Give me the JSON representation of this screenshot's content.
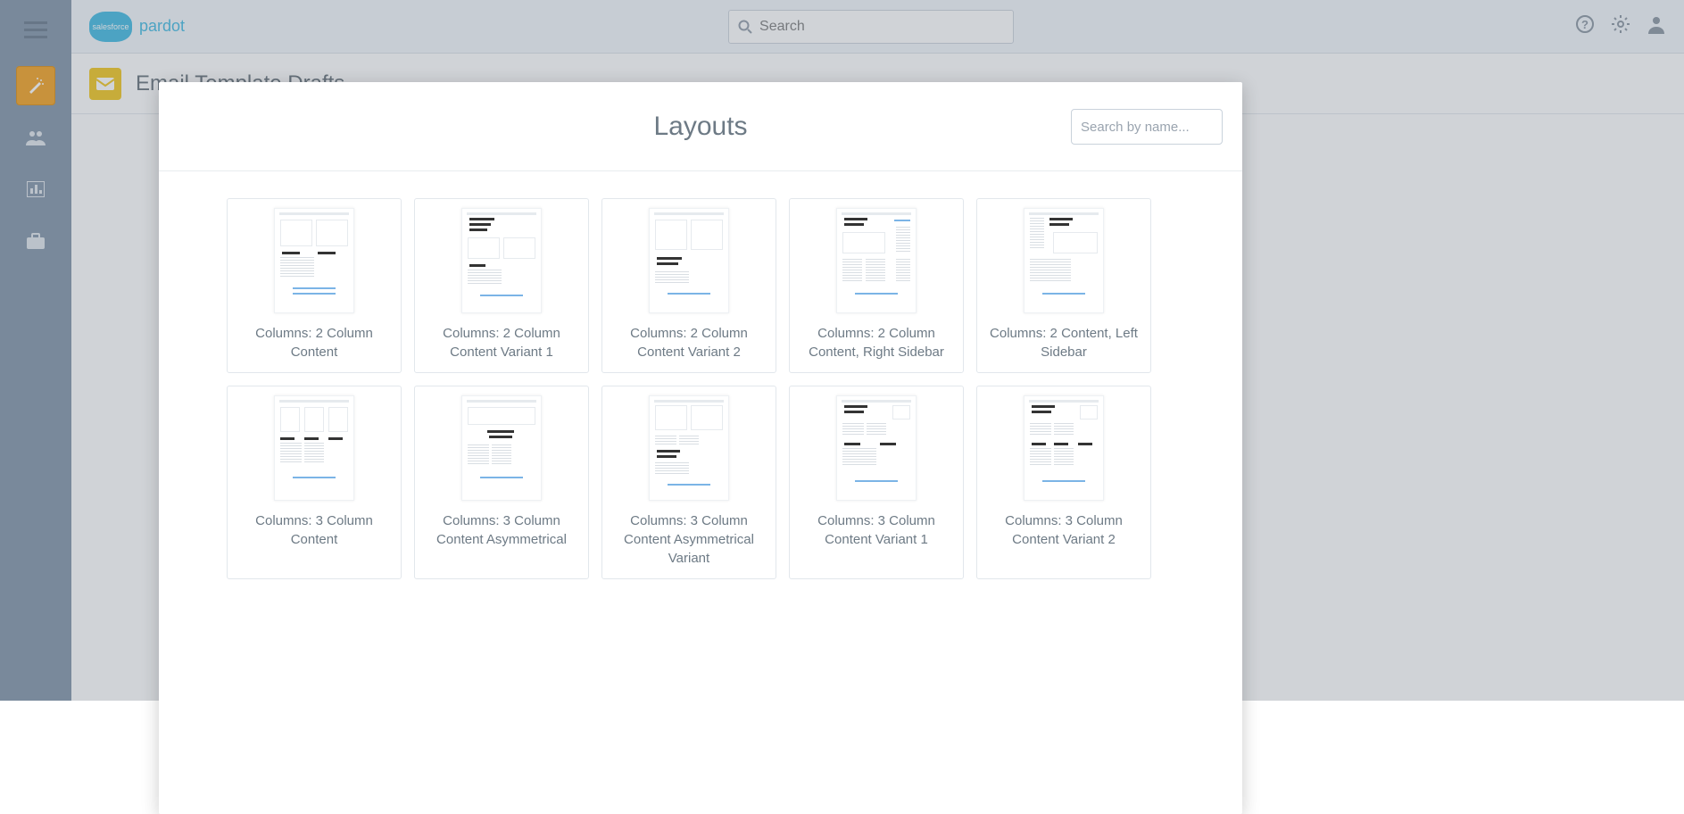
{
  "logo": {
    "cloud_text": "salesforce",
    "product": "pardot"
  },
  "top_search": {
    "placeholder": "Search"
  },
  "page": {
    "title": "Email Template Drafts"
  },
  "modal": {
    "title": "Layouts",
    "search_placeholder": "Search by name...",
    "layouts": [
      {
        "name": "Columns: 2 Column Content"
      },
      {
        "name": "Columns: 2 Column Content Variant 1"
      },
      {
        "name": "Columns: 2 Column Content Variant 2"
      },
      {
        "name": "Columns: 2 Column Content, Right Sidebar"
      },
      {
        "name": "Columns: 2 Content, Left Sidebar"
      },
      {
        "name": "Columns: 3 Column Content"
      },
      {
        "name": "Columns: 3 Column Content Asymmetrical"
      },
      {
        "name": "Columns: 3 Column Content Asymmetrical Variant"
      },
      {
        "name": "Columns: 3 Column Content Variant 1"
      },
      {
        "name": "Columns: 3 Column Content Variant 2"
      }
    ]
  }
}
